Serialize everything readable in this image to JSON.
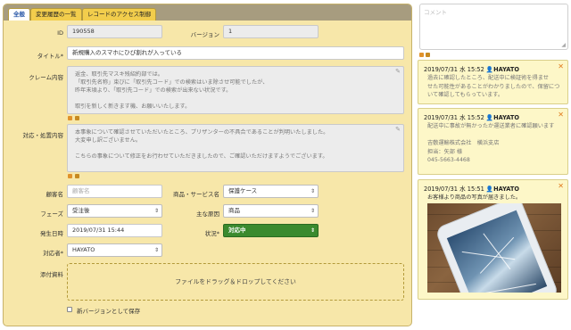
{
  "tabs": [
    {
      "label": "全般"
    },
    {
      "label": "変更履歴の一覧"
    },
    {
      "label": "レコードのアクセス制御"
    }
  ],
  "form": {
    "id": {
      "label": "ID",
      "value": "190558"
    },
    "version": {
      "label": "バージョン",
      "value": "1"
    },
    "title": {
      "label": "タイトル",
      "required": "*",
      "value": "新規購入のスマホにひび割れが入っている"
    },
    "claim": {
      "label": "クレーム内容",
      "lines": [
        "返金、取引先マスキ残紹約部では。",
        "「取引先名称」束びに「取引先コード」での検索はいま除させ可能でしたが、",
        "昨年末頃より、「取引先コード」での検索が出来ない状況です。",
        "",
        "取引を新しく新きます機、お願いいたします。"
      ]
    },
    "response": {
      "label": "対応・処置内容",
      "lines": [
        "本事象について確認させていただいたところ、プリザンターの不具合であることが判明いたしました。",
        "大変申し訳ございません。",
        "",
        "こちらの事象について修正をお行わせていただきましたので、ご確認いただけますようでございます。"
      ]
    },
    "customer": {
      "label": "顧客名",
      "placeholder": "顧客名"
    },
    "product": {
      "label": "商品・サービス名",
      "value": "保護ケース"
    },
    "phase": {
      "label": "フェーズ",
      "value": "受注後"
    },
    "cause": {
      "label": "主な原因",
      "value": "商品"
    },
    "date": {
      "label": "発生日時",
      "value": "2019/07/31 15:44"
    },
    "status": {
      "label": "状況",
      "required": "*",
      "value": "対応中"
    },
    "assignee": {
      "label": "対応者",
      "required": "*",
      "value": "HAYATO"
    },
    "attachments": {
      "label": "添付資料",
      "drop_text": "ファイルをドラッグ＆ドロップしてください"
    },
    "save_new_version": {
      "label": "新バージョンとして保存"
    }
  },
  "comment": {
    "placeholder": "コメント"
  },
  "comments": [
    {
      "time": "2019/07/31 水 15:52",
      "user": "HAYATO",
      "lines": [
        "過去に確認したところ、配送中に検証術を得ませ",
        "せた可能性があることがわかりましたので、保留につ",
        "いて確認してもらっています。"
      ]
    },
    {
      "time": "2019/07/31 水 15:52",
      "user": "HAYATO",
      "lines": [
        "配送中に事故が無かったか運送業者に確認願います",
        "",
        "吉敷運輸株式会社　横浜支店",
        "担当：矢部 様",
        "045-5663-4468"
      ]
    },
    {
      "time": "2019/07/31 水 15:51",
      "user": "HAYATO",
      "lines": [
        "お客様より商品の写真が届きました。"
      ]
    }
  ],
  "colors": {
    "panel": "#f7e7a9",
    "tab": "#f2cd4c",
    "active_tab_text": "#2a58a8",
    "status_green": "#3b8a2e",
    "card": "#fdf7c8",
    "close": "#e07a1c"
  }
}
